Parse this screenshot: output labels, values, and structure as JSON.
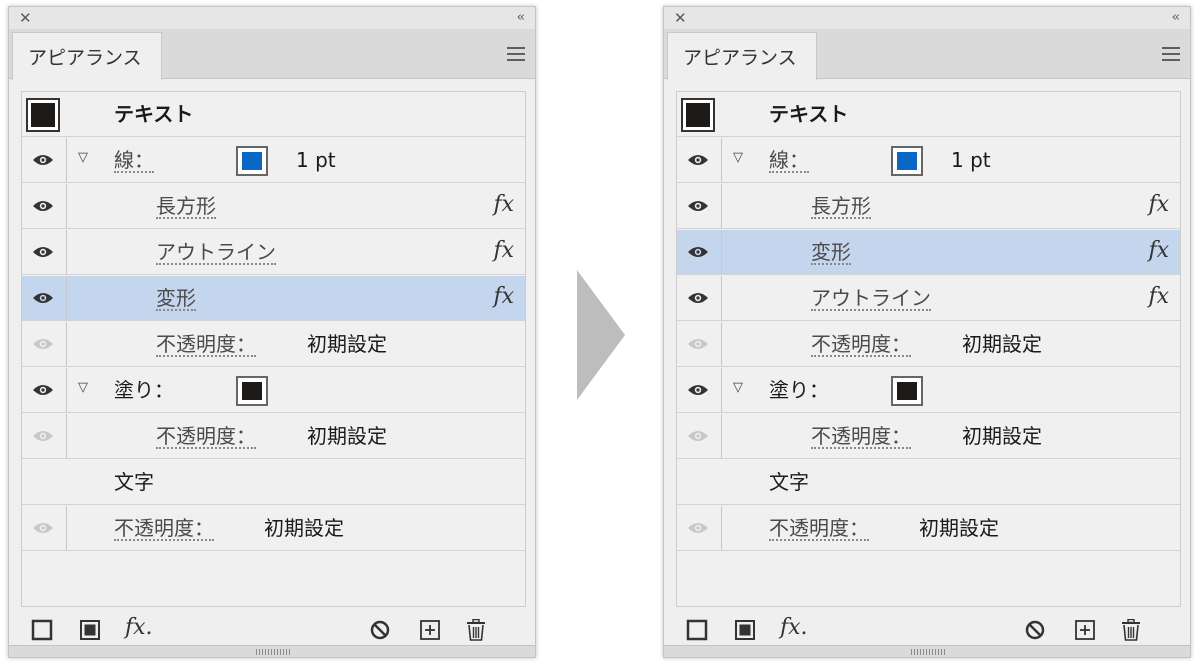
{
  "panel_title": "アピアランス",
  "object_label": "テキスト",
  "stroke_label": "線：",
  "stroke_weight": "1 pt",
  "fill_label": "塗り：",
  "opacity_label": "不透明度：",
  "opacity_value": "初期設定",
  "characters_label": "文字",
  "effects": {
    "rectangle": "長方形",
    "outline": "アウトライン",
    "transform": "変形"
  },
  "colors": {
    "stroke_swatch": "#0a68c4",
    "fill_swatch": "#1e1a17",
    "selection": "#c4d5ee",
    "arrow": "#bdbdbd"
  },
  "icons": {
    "close": "close-icon",
    "collapse": "double-chevron-left-icon",
    "menu": "hamburger-menu-icon",
    "visibility": "eye-icon",
    "expand": "chevron-down-icon",
    "effect": "fx-icon",
    "add_stroke": "add-new-stroke-icon",
    "add_fill": "add-new-fill-icon",
    "add_effect": "add-new-effect-icon",
    "clear": "clear-appearance-icon",
    "duplicate": "duplicate-item-icon",
    "delete": "trash-icon"
  },
  "left_effect_order": [
    "rectangle",
    "outline",
    "transform"
  ],
  "right_effect_order": [
    "rectangle",
    "transform",
    "outline"
  ]
}
